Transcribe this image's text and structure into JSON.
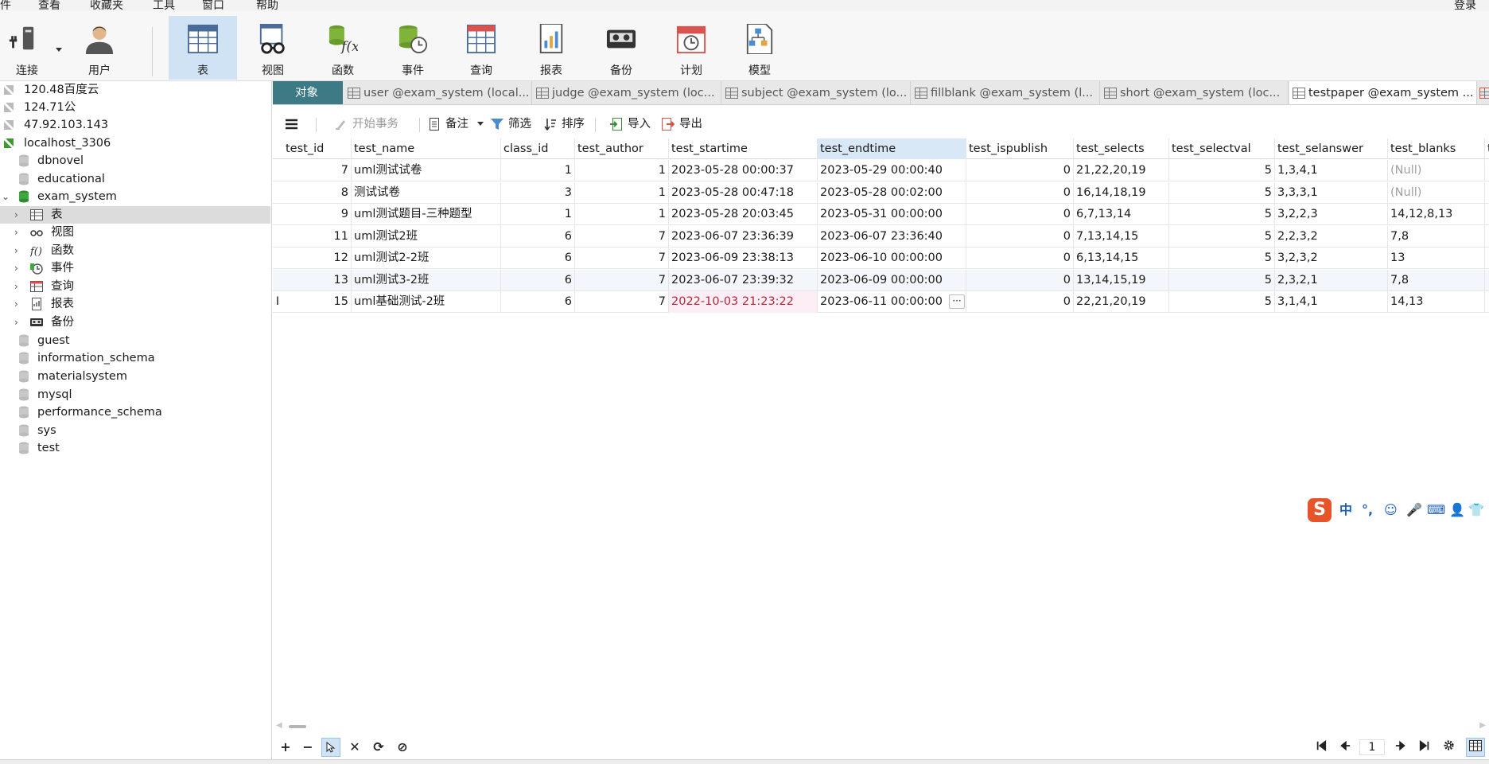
{
  "menu": {
    "items": [
      "件",
      "查看",
      "收藏夹",
      "工具",
      "窗口",
      "帮助"
    ],
    "login": "登录"
  },
  "toolbar": {
    "buttons": [
      {
        "label": "连接",
        "icon": "plug-icon"
      },
      {
        "label": "用户",
        "icon": "user-icon"
      },
      {
        "label": "表",
        "icon": "table-icon"
      },
      {
        "label": "视图",
        "icon": "view-icon"
      },
      {
        "label": "函数",
        "icon": "function-icon"
      },
      {
        "label": "事件",
        "icon": "event-icon"
      },
      {
        "label": "查询",
        "icon": "query-icon"
      },
      {
        "label": "报表",
        "icon": "report-icon"
      },
      {
        "label": "备份",
        "icon": "backup-icon"
      },
      {
        "label": "计划",
        "icon": "schedule-icon"
      },
      {
        "label": "模型",
        "icon": "model-icon"
      }
    ]
  },
  "sidebar": {
    "connections": [
      "120.48百度云",
      "124.71公",
      "47.92.103.143",
      "localhost_3306"
    ],
    "databases_top": [
      "dbnovel",
      "educational"
    ],
    "open_database": "exam_system",
    "object_types": [
      "表",
      "视图",
      "函数",
      "事件",
      "查询",
      "报表",
      "备份"
    ],
    "databases_bottom": [
      "guest",
      "information_schema",
      "materialsystem",
      "mysql",
      "performance_schema",
      "sys",
      "test"
    ]
  },
  "tabs": {
    "objects_label": "对象",
    "items": [
      "user @exam_system (local...",
      "judge @exam_system (loc...",
      "subject @exam_system (lo...",
      "fillblank @exam_system (l...",
      "short @exam_system (loc...",
      "testpaper @exam_system ..."
    ]
  },
  "objbar": {
    "begin_transaction": "开始事务",
    "note": "备注",
    "filter": "筛选",
    "sort": "排序",
    "import": "导入",
    "export": "导出"
  },
  "table": {
    "columns": [
      "test_id",
      "test_name",
      "class_id",
      "test_author",
      "test_startime",
      "test_endtime",
      "test_ispublish",
      "test_selects",
      "test_selectval",
      "test_selanswer",
      "test_blanks",
      "t"
    ],
    "rows": [
      [
        "7",
        "uml测试试卷",
        "1",
        "1",
        "2023-05-28 00:00:37",
        "2023-05-29 00:00:40",
        "0",
        "21,22,20,19",
        "5",
        "1,3,4,1",
        "(Null)"
      ],
      [
        "8",
        "测试试卷",
        "3",
        "1",
        "2023-05-28 00:47:18",
        "2023-05-28 00:02:00",
        "0",
        "16,14,18,19",
        "5",
        "3,3,3,1",
        "(Null)"
      ],
      [
        "9",
        "uml测试题目-三种题型",
        "1",
        "1",
        "2023-05-28 20:03:45",
        "2023-05-31 00:00:00",
        "0",
        "6,7,13,14",
        "5",
        "3,2,2,3",
        "14,12,8,13"
      ],
      [
        "11",
        "uml测试2班",
        "6",
        "7",
        "2023-06-07 23:36:39",
        "2023-06-07 23:36:40",
        "0",
        "7,13,14,15",
        "5",
        "2,2,3,2",
        "7,8"
      ],
      [
        "12",
        "uml测试2-2班",
        "6",
        "7",
        "2023-06-09 23:38:13",
        "2023-06-10 00:00:00",
        "0",
        "6,13,14,15",
        "5",
        "3,2,3,2",
        "13"
      ],
      [
        "13",
        "uml测试3-2班",
        "6",
        "7",
        "2023-06-07 23:39:32",
        "2023-06-09 00:00:00",
        "0",
        "13,14,15,19",
        "5",
        "2,3,2,1",
        "7,8"
      ],
      [
        "15",
        "uml基础测试-2班",
        "6",
        "7",
        "2022-10-03 21:23:22",
        "2023-06-11 00:00:00",
        "0",
        "22,21,20,19",
        "5",
        "3,1,4,1",
        "14,13"
      ]
    ],
    "cursor_row_marker": "I",
    "editing_ellipsis": "···"
  },
  "bottom": {
    "page_number": "1",
    "add": "+",
    "remove": "−",
    "discard": "✕",
    "refresh": "⟳",
    "stop": "⊘"
  },
  "ime": {
    "logo": "S",
    "mode": "中",
    "punct": "°,",
    "items": [
      "☺",
      "🎤",
      "⌨",
      "👤",
      "👕"
    ]
  },
  "colors": {
    "accent": "#3c7a86",
    "selection": "#cfe3f5",
    "edited_cell": "#b4283c",
    "null_text": "#a0a0a0"
  }
}
